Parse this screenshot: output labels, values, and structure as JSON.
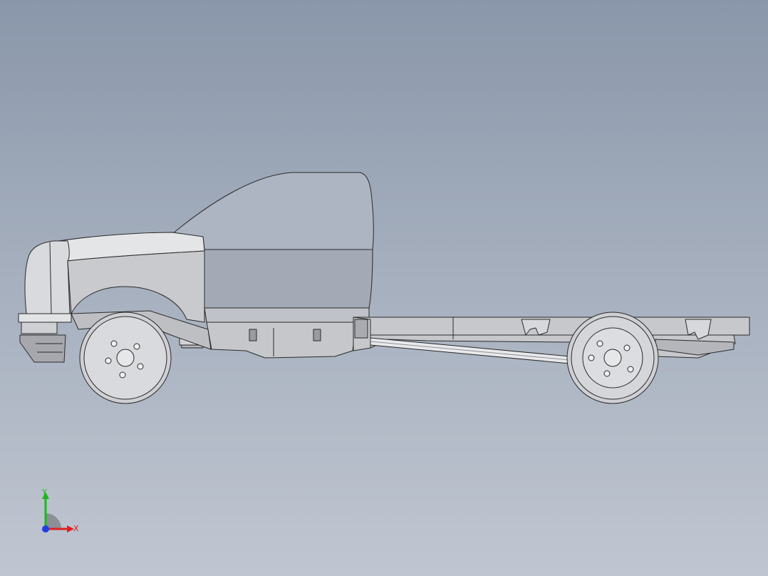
{
  "viewport": {
    "background_top": "#8a97aa",
    "background_bottom": "#c0c6d1"
  },
  "model": {
    "body_color": "#d6d7da",
    "shade_color": "#b9bbc0",
    "dark_color": "#8f9197",
    "edge_color": "#2a2a2a",
    "cab_color": "#aeb5c2"
  },
  "triad": {
    "y_label": "Y",
    "x_label": "X",
    "y_color": "#1bb81b",
    "x_color": "#e02020",
    "z_color": "#2040e0"
  }
}
